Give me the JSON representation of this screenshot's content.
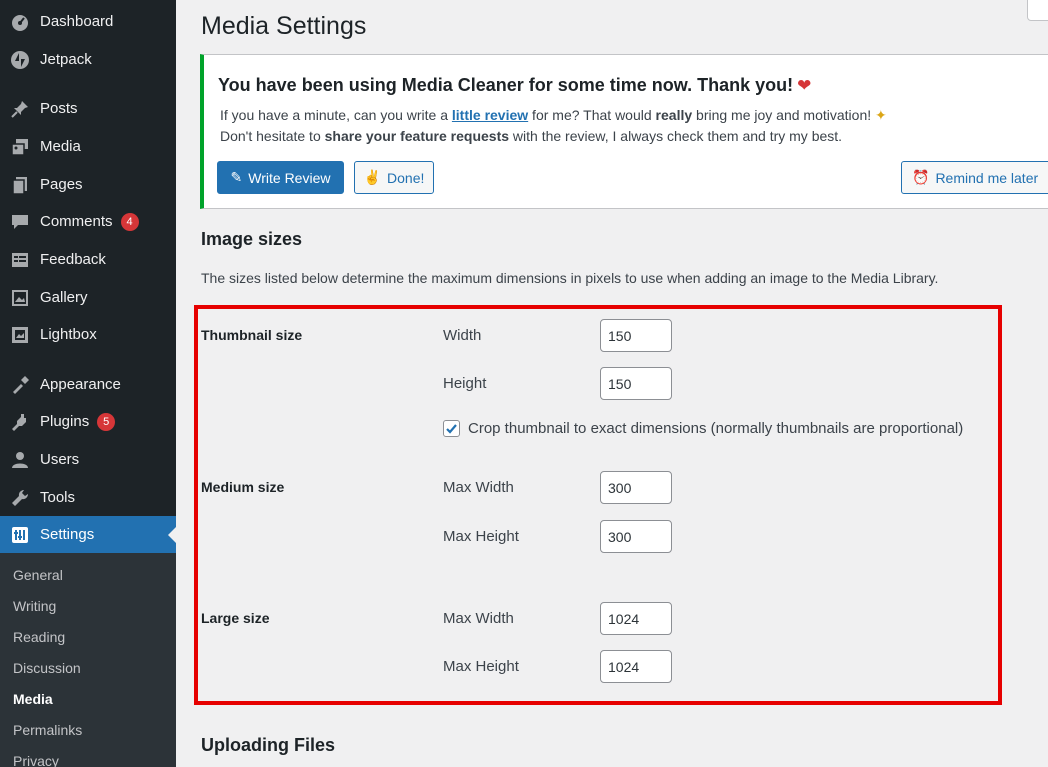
{
  "sidebar": {
    "items": [
      {
        "label": "Dashboard",
        "icon": "dashboard-icon"
      },
      {
        "label": "Jetpack",
        "icon": "jetpack-icon"
      },
      {
        "label": "Posts",
        "icon": "pin-icon"
      },
      {
        "label": "Media",
        "icon": "media-icon"
      },
      {
        "label": "Pages",
        "icon": "pages-icon"
      },
      {
        "label": "Comments",
        "icon": "comments-icon",
        "badge": "4"
      },
      {
        "label": "Feedback",
        "icon": "feedback-icon"
      },
      {
        "label": "Gallery",
        "icon": "gallery-icon"
      },
      {
        "label": "Lightbox",
        "icon": "lightbox-icon"
      },
      {
        "label": "Appearance",
        "icon": "appearance-icon"
      },
      {
        "label": "Plugins",
        "icon": "plugins-icon",
        "badge": "5"
      },
      {
        "label": "Users",
        "icon": "users-icon"
      },
      {
        "label": "Tools",
        "icon": "tools-icon"
      },
      {
        "label": "Settings",
        "icon": "settings-icon"
      }
    ],
    "submenu": [
      "General",
      "Writing",
      "Reading",
      "Discussion",
      "Media",
      "Permalinks",
      "Privacy"
    ],
    "current_submenu": "Media",
    "accent_color": "#2271b1"
  },
  "page": {
    "title": "Media Settings"
  },
  "notice": {
    "heading": "You have been using Media Cleaner for some time now. Thank you!",
    "line1_prefix": "If you have a minute, can you write a ",
    "line1_link": "little review",
    "line1_mid": " for me? That would ",
    "line1_bold": "really",
    "line1_suffix": " bring me joy and motivation! ",
    "line2_prefix": "Don't hesitate to ",
    "line2_bold": "share your feature requests",
    "line2_suffix": " with the review, I always check them and try my best.",
    "write_review_label": "Write Review",
    "done_label": "Done!",
    "remind_label": "Remind me later",
    "border_color": "#00a32a"
  },
  "image_sizes": {
    "heading": "Image sizes",
    "description": "The sizes listed below determine the maximum dimensions in pixels to use when adding an image to the Media Library.",
    "thumbnail": {
      "label": "Thumbnail size",
      "width_label": "Width",
      "width": "150",
      "height_label": "Height",
      "height": "150",
      "crop_label": "Crop thumbnail to exact dimensions (normally thumbnails are proportional)",
      "crop_checked": true
    },
    "medium": {
      "label": "Medium size",
      "width_label": "Max Width",
      "width": "300",
      "height_label": "Max Height",
      "height": "300"
    },
    "large": {
      "label": "Large size",
      "width_label": "Max Width",
      "width": "1024",
      "height_label": "Max Height",
      "height": "1024"
    },
    "highlight_color": "#e60000"
  },
  "uploading": {
    "heading": "Uploading Files"
  }
}
